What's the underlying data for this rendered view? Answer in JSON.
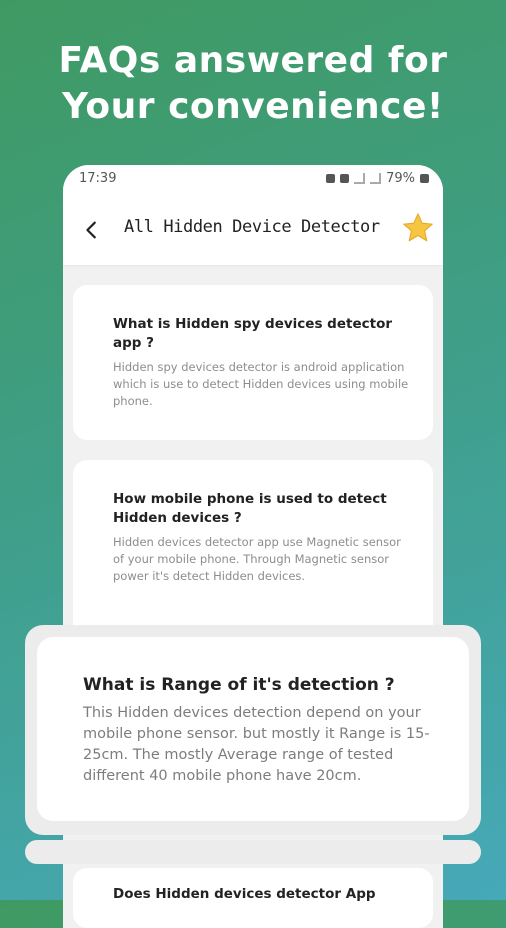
{
  "headline": {
    "line1": "FAQs answered for",
    "line2": "Your convenience!"
  },
  "statusbar": {
    "time": "17:39",
    "battery": "79%"
  },
  "appbar": {
    "title": "All Hidden Device Detector",
    "back_icon": "chevron-left-icon",
    "favorite_icon": "star-icon",
    "favorite_color": "#f7c641"
  },
  "faq": [
    {
      "question": "What is Hidden spy devices detector app ?",
      "answer": "Hidden spy devices detector is android application which is use to detect Hidden devices using mobile phone."
    },
    {
      "question": "How mobile phone is used to detect Hidden devices ?",
      "answer": "Hidden devices detector app use Magnetic sensor of your mobile phone. Through Magnetic sensor power it's detect Hidden devices."
    },
    {
      "question": "What is Range of it's detection ?",
      "answer": "This Hidden devices detection depend on your mobile phone sensor. but mostly it Range is 15-25cm. The mostly Average range of tested different 40 mobile phone have 20cm."
    },
    {
      "question": "Does Hidden devices detector App"
    }
  ],
  "colors": {
    "background_start": "#3f9a62",
    "background_end": "#46a9b8",
    "answer_text": "#8d8d8d"
  }
}
